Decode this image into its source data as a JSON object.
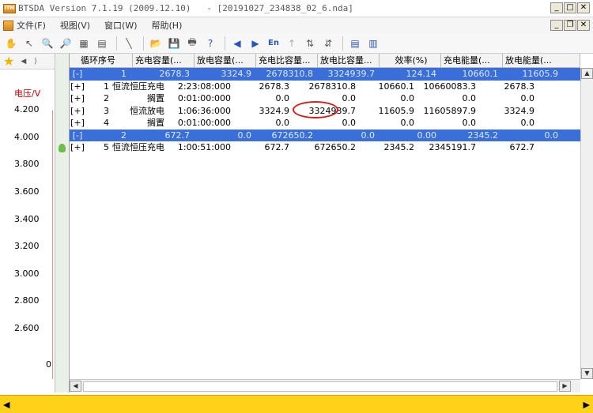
{
  "window": {
    "title": "BTSDA Version 7.1.19 (2009.12.10)   - [20191027_234838_02_6.nda]",
    "app_icon": "app-logo-icon"
  },
  "menu": {
    "items": [
      "文件(F)",
      "视图(V)",
      "窗口(W)",
      "帮助(H)"
    ]
  },
  "toolbar": {
    "buttons": [
      "hand-icon",
      "pointer-icon",
      "zoom-in-icon",
      "zoom-out-icon",
      "scale-icon",
      "scale-alt-icon",
      "line-icon",
      "open-folder-icon",
      "save-icon",
      "print-icon",
      "help-icon",
      "back-icon",
      "forward-icon",
      "en-icon",
      "up-arrow-icon",
      "sort-asc-icon",
      "sort-desc-icon",
      "grid-icon",
      "grid-alt-icon"
    ],
    "en_label": "En"
  },
  "left_panel": {
    "ylabel": "电压/V",
    "ticks": [
      "4.200",
      "4.000",
      "3.800",
      "3.600",
      "3.400",
      "3.200",
      "3.000",
      "2.800",
      "2.600",
      "0"
    ]
  },
  "table": {
    "headers": [
      "循环序号",
      "充电容量(...",
      "放电容量(...",
      "充电比容量...",
      "放电比容量...",
      "效率(%)",
      "充电能量(...",
      "放电能量(..."
    ],
    "groups": [
      {
        "label": "1",
        "values": [
          "2678.3",
          "3324.9",
          "2678310.8",
          "3324939.7",
          "124.14",
          "10660.1",
          "11605.9"
        ],
        "rows": [
          {
            "expand": "[+]",
            "idx": "1",
            "type": "恒流恒压充电",
            "time": "2:23:08:000",
            "a": "2678.3",
            "b": "2678310.8",
            "c": "10660.1",
            "d": "10660083.3",
            "e": "2678.3"
          },
          {
            "expand": "[+]",
            "idx": "2",
            "type": "搁置",
            "time": "0:01:00:000",
            "a": "0.0",
            "b": "0.0",
            "c": "0.0",
            "d": "0.0",
            "e": "0.0"
          },
          {
            "expand": "[+]",
            "idx": "3",
            "type": "恒流放电",
            "time": "1:06:36:000",
            "a": "3324.9",
            "b": "3324939.7",
            "c": "11605.9",
            "d": "11605897.9",
            "e": "3324.9"
          },
          {
            "expand": "[+]",
            "idx": "4",
            "type": "搁置",
            "time": "0:01:00:000",
            "a": "0.0",
            "b": "0.0",
            "c": "0.0",
            "d": "0.0",
            "e": "0.0"
          }
        ]
      },
      {
        "label": "2",
        "values": [
          "672.7",
          "0.0",
          "672650.2",
          "0.0",
          "0.00",
          "2345.2",
          "0.0"
        ],
        "rows": [
          {
            "expand": "[+]",
            "idx": "5",
            "type": "恒流恒压充电",
            "time": "1:00:51:000",
            "a": "672.7",
            "b": "672650.2",
            "c": "2345.2",
            "d": "2345191.7",
            "e": "672.7"
          }
        ]
      }
    ]
  }
}
